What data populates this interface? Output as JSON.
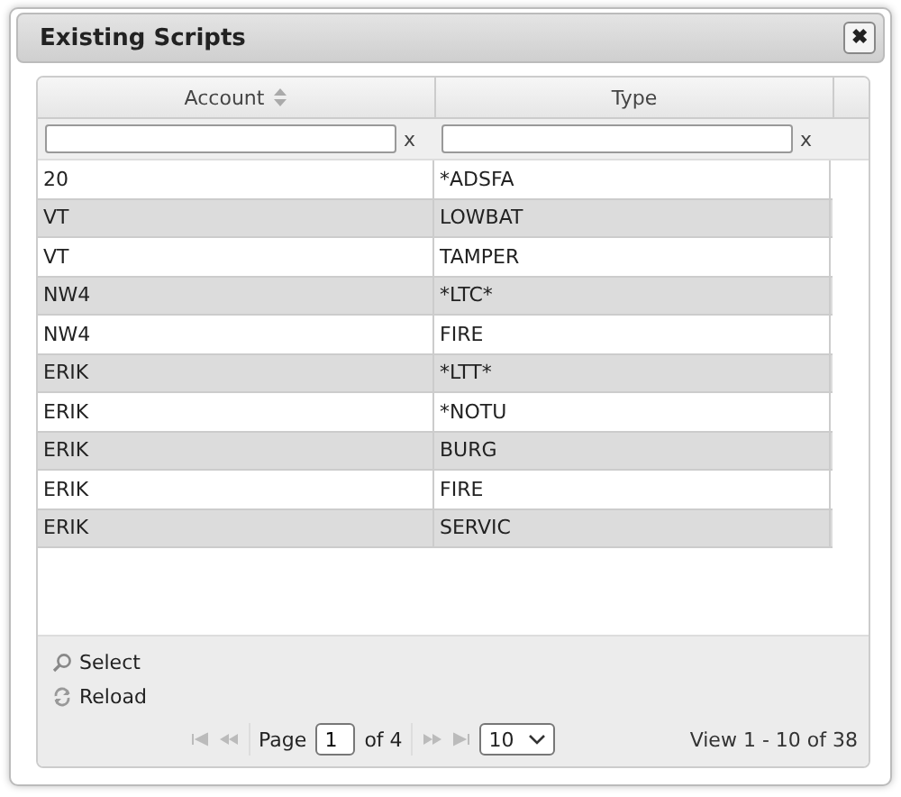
{
  "dialog": {
    "title": "Existing Scripts",
    "close": "✖"
  },
  "table": {
    "columns": [
      {
        "label": "Account",
        "sortable": true
      },
      {
        "label": "Type",
        "sortable": false
      }
    ],
    "filters": [
      {
        "clear": "x"
      },
      {
        "clear": "x"
      }
    ],
    "rows": [
      [
        "20",
        "*ADSFA"
      ],
      [
        "VT",
        "LOWBAT"
      ],
      [
        "VT",
        "TAMPER"
      ],
      [
        "NW4",
        "*LTC*"
      ],
      [
        "NW4",
        "FIRE"
      ],
      [
        "ERIK",
        "*LTT*"
      ],
      [
        "ERIK",
        "*NOTU"
      ],
      [
        "ERIK",
        "BURG"
      ],
      [
        "ERIK",
        "FIRE"
      ],
      [
        "ERIK",
        "SERVIC"
      ]
    ]
  },
  "actions": [
    {
      "kind": "search",
      "label": "Select"
    },
    {
      "kind": "reload",
      "label": "Reload"
    }
  ],
  "pager": {
    "page_label": "Page",
    "page": "1",
    "of": "of 4",
    "page_size": "10",
    "view": "View 1 - 10 of 38"
  }
}
